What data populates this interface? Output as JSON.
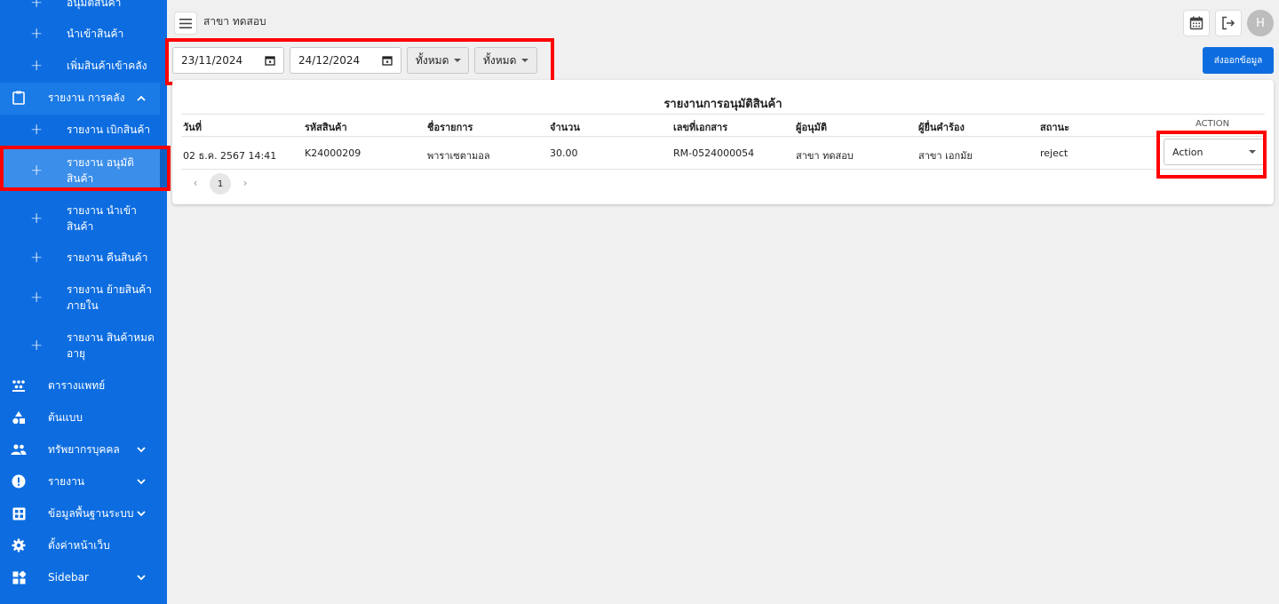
{
  "sidebar": {
    "items": [
      {
        "label": "อนุมัติสินค้า"
      },
      {
        "label": "นำเข้าสินค้า"
      },
      {
        "label": "เพิ่มสินค้าเข้าคลัง"
      },
      {
        "label": "รายงาน การคลัง"
      },
      {
        "label": "รายงาน เบิกสินค้า"
      },
      {
        "label": "รายงาน อนุมัติสินค้า"
      },
      {
        "label": "รายงาน นำเข้าสินค้า"
      },
      {
        "label": "รายงาน คืนสินค้า"
      },
      {
        "label": "รายงาน ย้ายสินค้าภายใน"
      },
      {
        "label": "รายงาน สินค้าหมดอายุ"
      },
      {
        "label": "ตารางแพทย์"
      },
      {
        "label": "ต้นแบบ"
      },
      {
        "label": "ทรัพยากรบุคคล"
      },
      {
        "label": "รายงาน"
      },
      {
        "label": "ข้อมูลพื้นฐานระบบ"
      },
      {
        "label": "ตั้งค่าหน้าเว็บ"
      },
      {
        "label": "Sidebar"
      }
    ]
  },
  "header": {
    "branch": "สาขา ทดสอบ",
    "avatar": "H"
  },
  "filters": {
    "start_date": "23/11/2024",
    "end_date": "24/12/2024",
    "select1": "ทั้งหมด",
    "select2": "ทั้งหมด",
    "export_label": "ส่งออกข้อมูล"
  },
  "report": {
    "title": "รายงานการอนุมัติสินค้า",
    "columns": [
      "วันที่",
      "รหัสสินค้า",
      "ชื่อรายการ",
      "จำนวน",
      "เลขที่เอกสาร",
      "ผู้อนุมัติ",
      "ผู้ยื่นคำร้อง",
      "สถานะ",
      "ACTION"
    ],
    "rows": [
      {
        "date": "02 ธ.ค. 2567 14:41",
        "code": "K24000209",
        "name": "พาราเซตามอล",
        "qty": "30.00",
        "doc": "RM-0524000054",
        "approver": "สาขา ทดสอบ",
        "requester": "สาขา เอกมัย",
        "status": "reject",
        "action": "Action"
      }
    ],
    "page": "1"
  },
  "colors": {
    "sidebar_bg": "#0d6de0",
    "highlight": "#ff0000"
  }
}
